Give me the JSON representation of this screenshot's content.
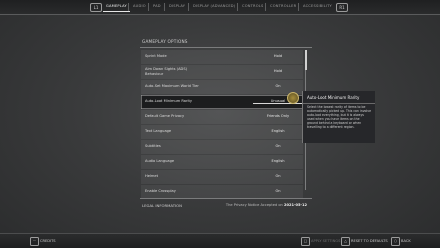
{
  "nav": {
    "left_hint": "L1",
    "right_hint": "R1",
    "tabs": [
      {
        "label": "GAMEPLAY",
        "active": true
      },
      {
        "label": "AUDIO",
        "active": false
      },
      {
        "label": "PAD",
        "active": false
      },
      {
        "label": "DISPLAY",
        "active": false
      },
      {
        "label": "DISPLAY (ADVANCED)",
        "active": false
      },
      {
        "label": "CONTROLS",
        "active": false
      },
      {
        "label": "CONTROLLER",
        "active": false
      },
      {
        "label": "ACCESSIBILITY",
        "active": false
      }
    ]
  },
  "section": {
    "title": "GAMEPLAY OPTIONS"
  },
  "options": [
    {
      "label": "Sprint Mode",
      "value": "Hold"
    },
    {
      "label": "Aim Down Sights (ADS) Behaviour",
      "value": "Hold",
      "two_line": true
    },
    {
      "label": "Auto-Set Maximum World Tier",
      "value": "On"
    },
    {
      "label": "Auto-Loot Minimum Rarity",
      "value": "Unusual",
      "selected": true
    },
    {
      "label": "Default Game Privacy",
      "value": "Friends Only"
    },
    {
      "label": "Text Language",
      "value": "English"
    },
    {
      "label": "Subtitles",
      "value": "On"
    },
    {
      "label": "Audio Language",
      "value": "English"
    },
    {
      "label": "Helmet",
      "value": "On"
    },
    {
      "label": "Enable Crossplay",
      "value": "On"
    }
  ],
  "legal": {
    "label": "LEGAL INFORMATION",
    "info_prefix": "The Privacy Notice Accepted on",
    "info_date": "2021-05-12"
  },
  "info_panel": {
    "title": "Auto-Loot Minimum Rarity",
    "body": "Select the lowest rarity of items to be automatically picked up. This can involve auto-loot everything, but it is always used when you have items on the ground behind a keyboard or when travelling to a different region."
  },
  "bottom": {
    "create_icon": "⋯",
    "create_label": "CREDITS",
    "apply_icon": "□",
    "apply_label": "APPLY SETTINGS",
    "reset_icon": "△",
    "reset_label": "RESET TO DEFAULTS",
    "back_icon": "○",
    "back_label": "BACK"
  },
  "colors": {
    "background": "#3a3b3c",
    "accent": "#a58d3a",
    "selected_row": "#1c1d1e"
  }
}
